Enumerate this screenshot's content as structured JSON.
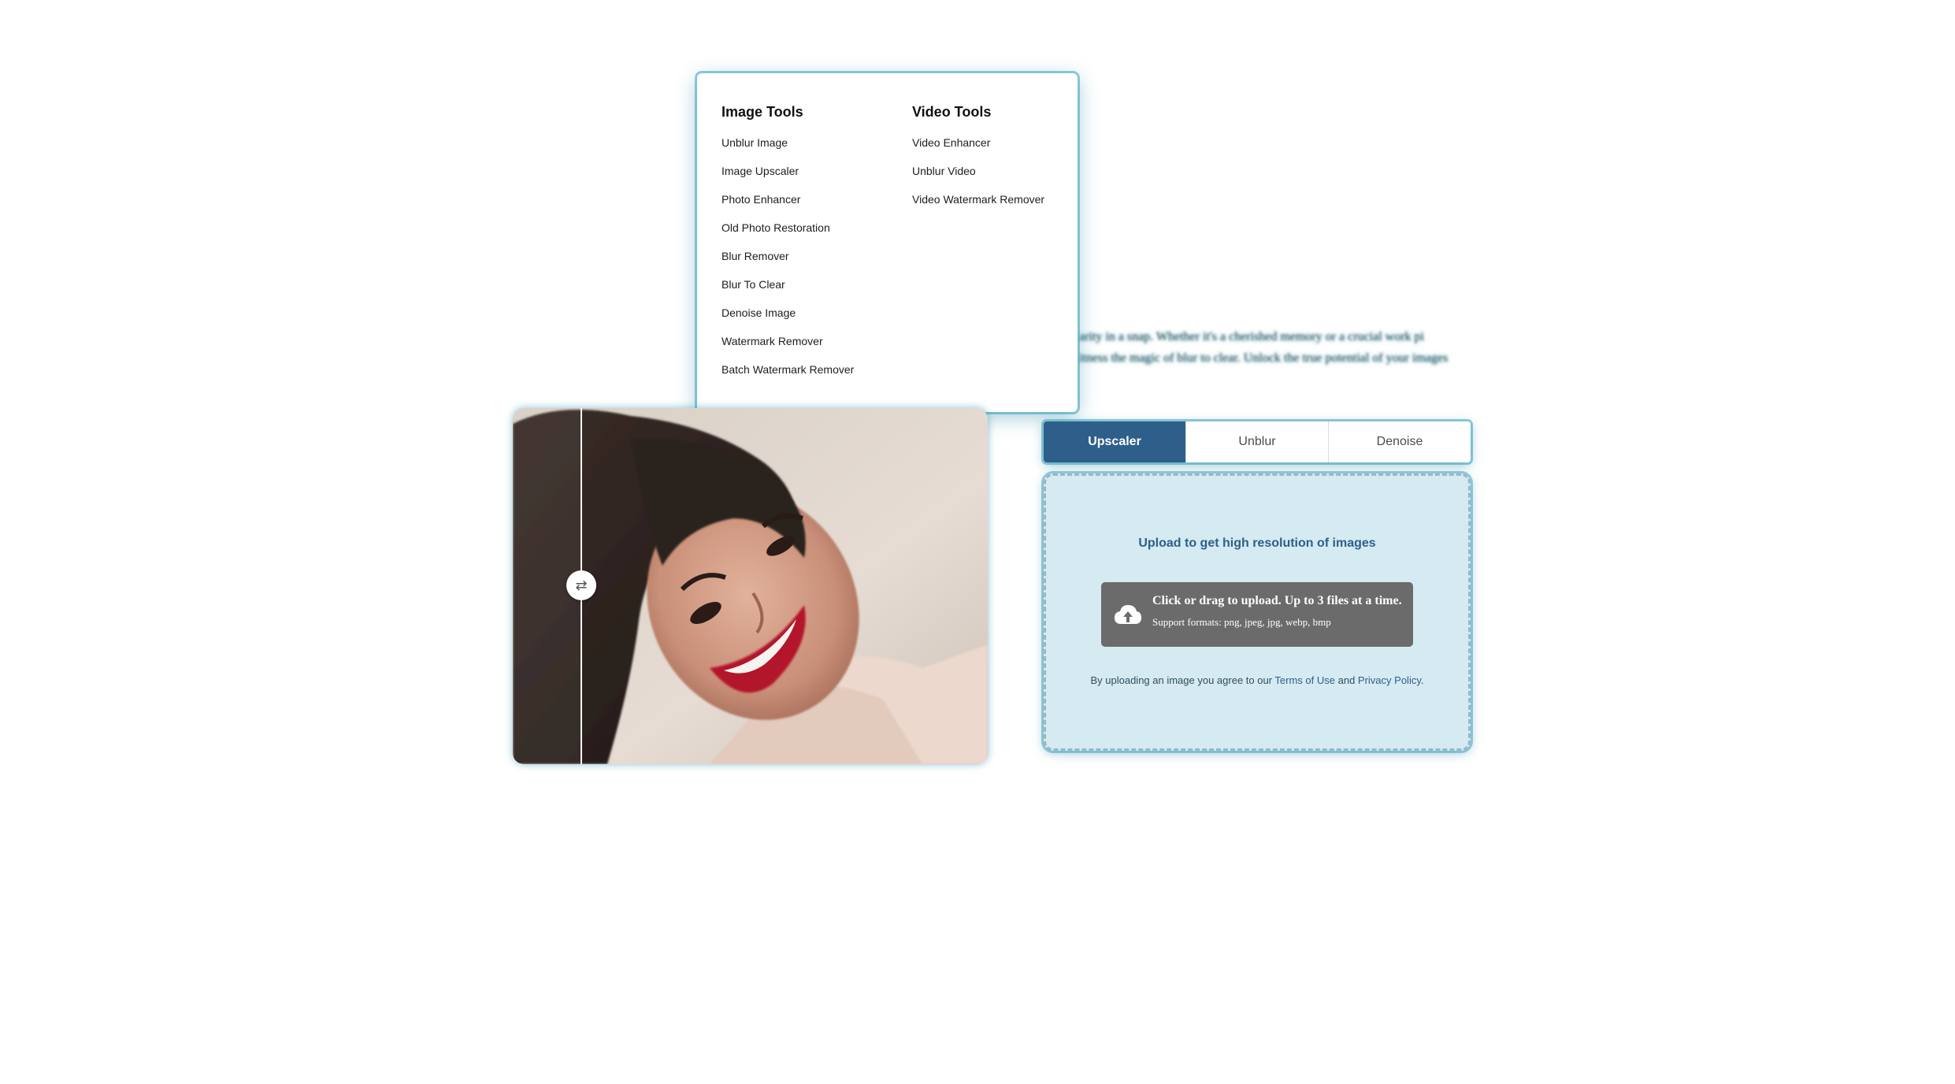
{
  "menu": {
    "image_tools": {
      "heading": "Image Tools",
      "items": [
        "Unblur Image",
        "Image Upscaler",
        "Photo Enhancer",
        "Old Photo Restoration",
        "Blur Remover",
        "Blur To Clear",
        "Denoise Image",
        "Watermark Remover",
        "Batch Watermark Remover"
      ]
    },
    "video_tools": {
      "heading": "Video Tools",
      "items": [
        "Video Enhancer",
        "Unblur Video",
        "Video Watermark Remover"
      ]
    }
  },
  "background_text": {
    "line1": "arity in a snap. Whether it's a cherished memory or a crucial work pi",
    "line2": "itness the magic of blur to clear. Unlock the true potential of your images"
  },
  "compare": {
    "handle_glyph": "⇄",
    "handle_icon": "swap-arrows-icon"
  },
  "tabs": [
    "Upscaler",
    "Unblur",
    "Denoise"
  ],
  "active_tab": "Upscaler",
  "upload": {
    "title": "Upload to get high resolution of images",
    "button_main": "Click or drag to upload. Up to 3 files at a time.",
    "button_sub": "Support formats: png, jpeg, jpg, webp, bmp",
    "button_icon": "cloud-upload-icon",
    "terms_prefix": "By uploading an image you agree to our ",
    "terms_link": "Terms of Use",
    "terms_and": " and ",
    "privacy_link": "Privacy Policy",
    "terms_suffix": "."
  },
  "colors": {
    "accent": "#2e5f8a",
    "glow": "#38a0ba",
    "upload_bg": "#d5eaf1",
    "upload_button": "#6b6b6b"
  }
}
